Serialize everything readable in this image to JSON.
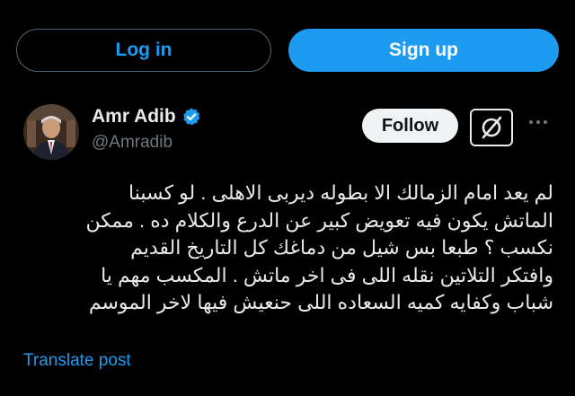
{
  "auth": {
    "login_label": "Log in",
    "signup_label": "Sign up"
  },
  "post": {
    "author": {
      "display_name": "Amr Adib",
      "handle": "@Amradib",
      "verified": true
    },
    "follow_label": "Follow",
    "text": "لم يعد امام الزمالك الا بطوله ديربى الاهلى . لو كسبنا\nالماتش يكون فيه تعويض كبير عن الدرع والكلام ده . ممكن\nنكسب ؟ طبعا بس شيل من دماغك كل التاريخ القديم\nوافتكر التلاتين نقله اللى فى اخر ماتش . المكسب مهم يا\nشباب وكفايه كميه السعاده اللى حنعيش فيها لاخر الموسم",
    "translate_label": "Translate post"
  },
  "icons": {
    "verified": "verified-badge-icon",
    "grok": "grok-icon",
    "more": "more-icon"
  },
  "colors": {
    "background": "#000000",
    "accent": "#1d9bf0",
    "text": "#e7e9ea",
    "muted": "#71767b"
  }
}
